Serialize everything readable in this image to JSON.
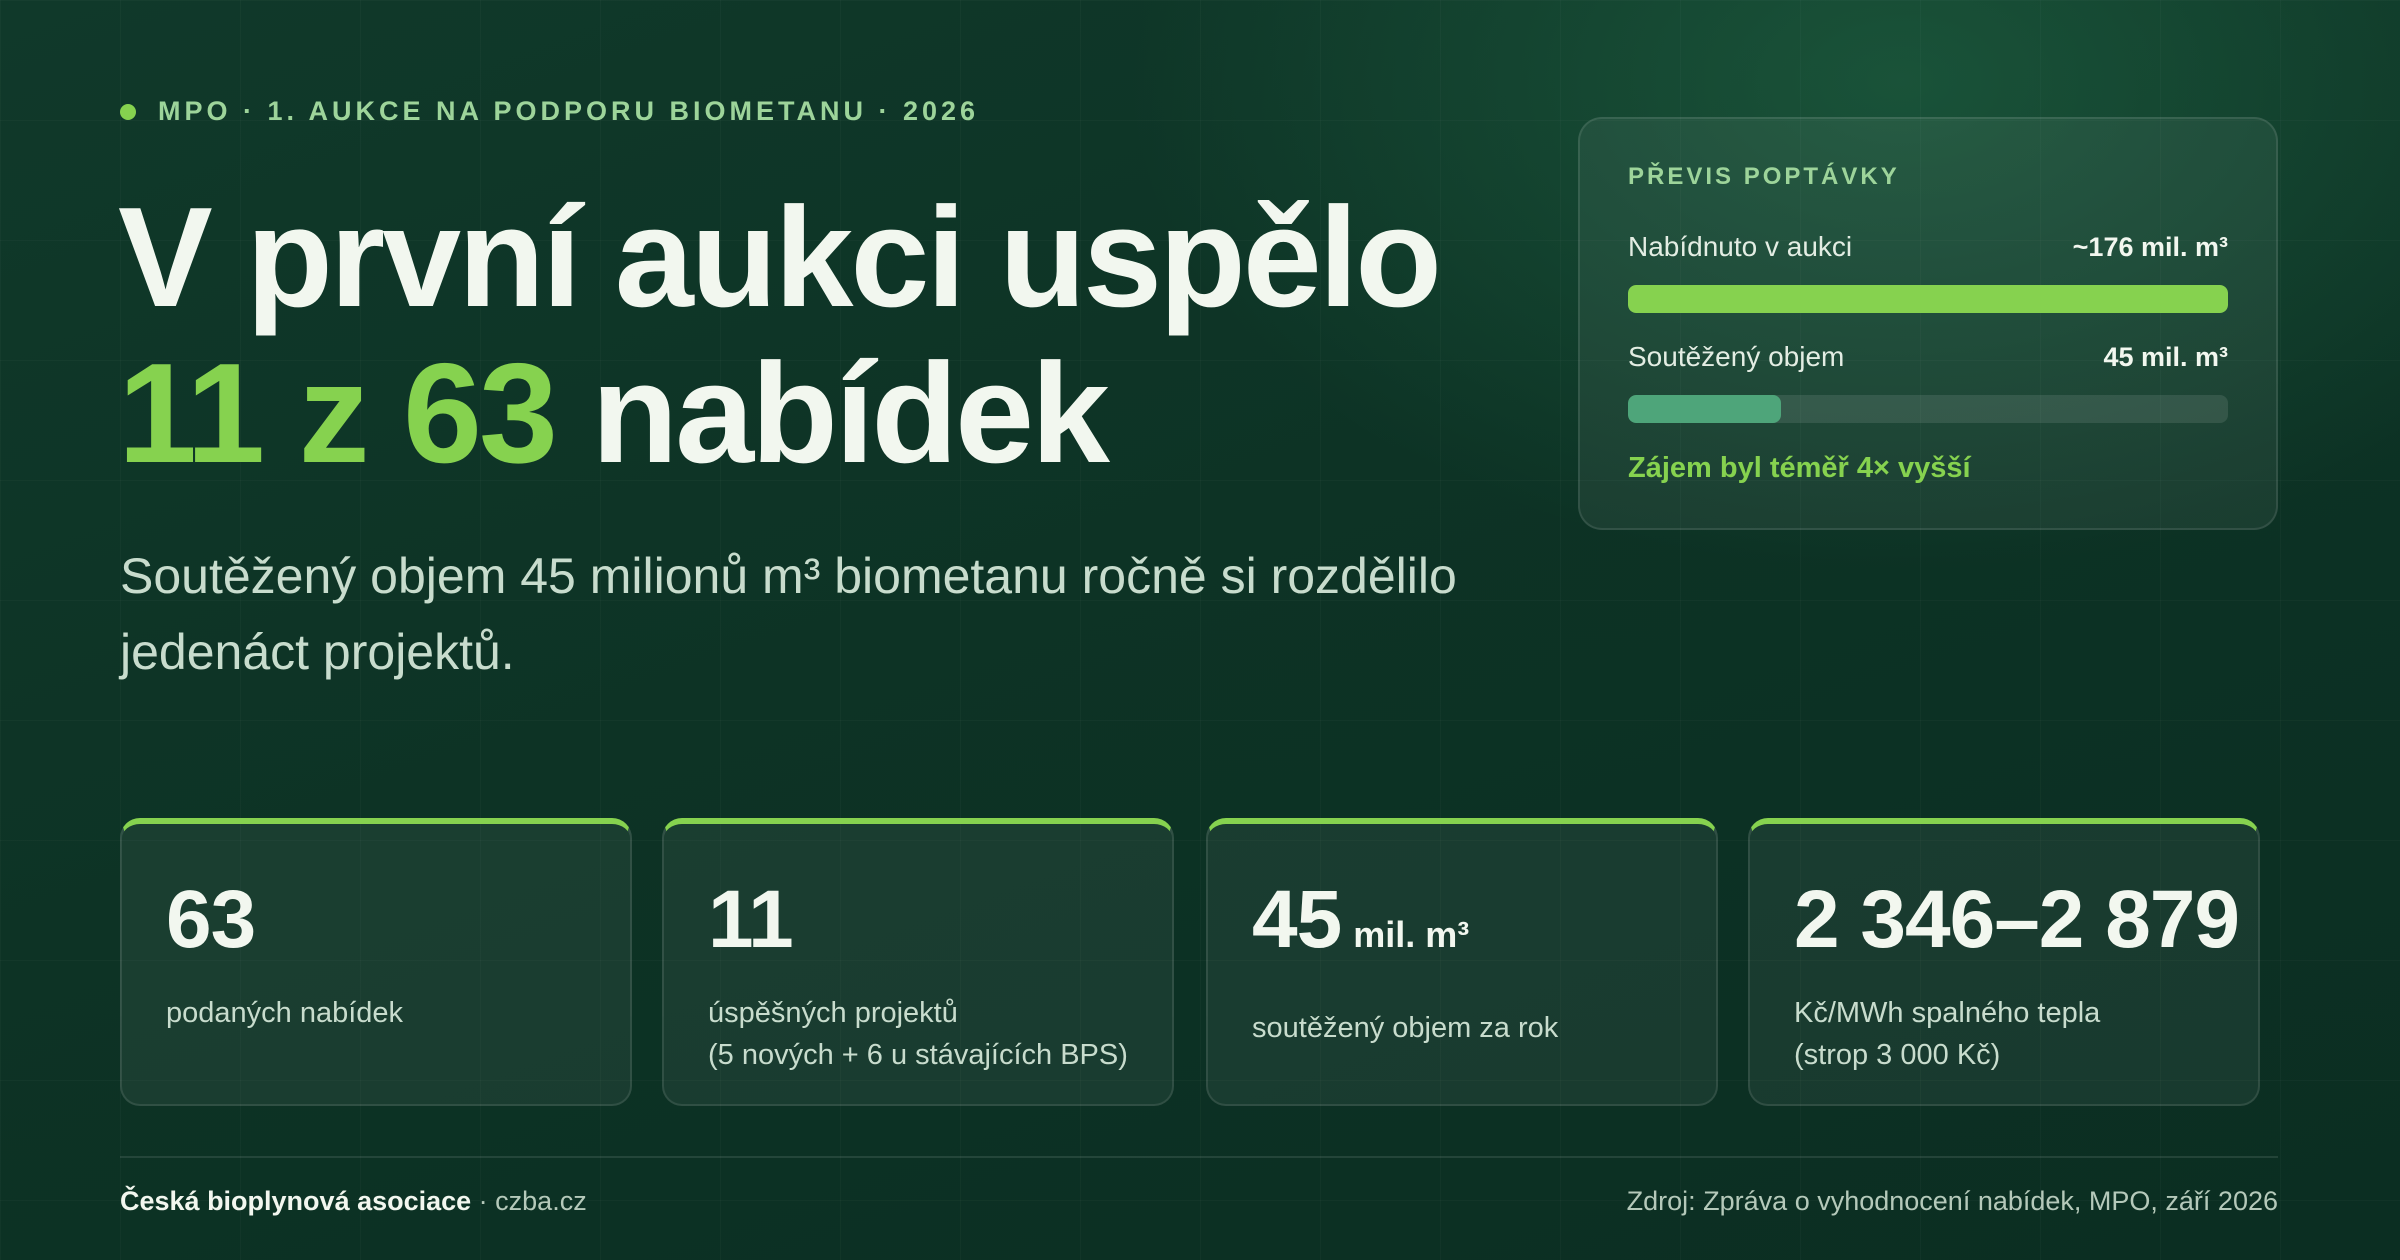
{
  "kicker": {
    "text": "MPO · 1. AUKCE NA PODPORU BIOMETANU · 2026",
    "accent_color": "#86d24f"
  },
  "headline": {
    "line1": "V první aukci uspělo",
    "line2_accent": "11 z 63",
    "line2_rest": "nabídek",
    "accent_color": "#86d24f"
  },
  "subtitle": "Soutěžený objem 45 milionů m³ biometanu ročně si rozdělilo jedenáct projektů.",
  "demand_card": {
    "title": "PŘEVIS POPTÁVKY",
    "bars": [
      {
        "label": "Nabídnuto v aukci",
        "value": "~176 mil. m³",
        "amount": 176,
        "color": "#86d24f"
      },
      {
        "label": "Soutěžený objem",
        "value": "45 mil. m³",
        "amount": 45,
        "color": "#4ea57a"
      }
    ],
    "note": "Zájem byl téměř 4× vyšší"
  },
  "stats": [
    {
      "number": "63",
      "unit": "",
      "desc1": "podaných nabídek",
      "desc2": ""
    },
    {
      "number": "11",
      "unit": "",
      "desc1": "úspěšných projektů",
      "desc2": "(5 nových + 6 u stávajících BPS)"
    },
    {
      "number": "45",
      "unit": "mil. m³",
      "desc1": "soutěžený objem za rok",
      "desc2": ""
    },
    {
      "number": "2 346–2 879",
      "unit": "",
      "desc1": "Kč/MWh spalného tepla",
      "desc2": "(strop 3 000 Kč)"
    }
  ],
  "footer": {
    "org": "Česká bioplynová asociace",
    "site": " · czba.cz",
    "source": "Zdroj: Zpráva o vyhodnocení nabídek, MPO, září 2026"
  }
}
